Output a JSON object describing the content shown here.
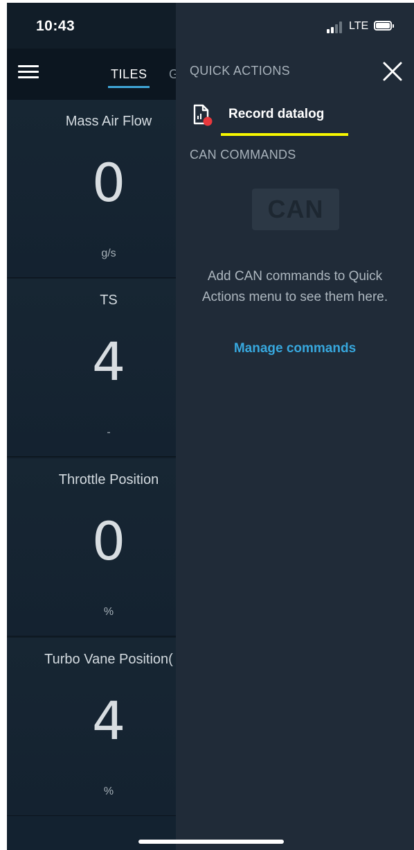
{
  "status_bar": {
    "time": "10:43",
    "network": "LTE"
  },
  "app": {
    "tab_active": "TILES",
    "tab_next_partial": "G"
  },
  "tiles": [
    {
      "title": "Mass Air Flow",
      "value": "0",
      "unit": "g/s"
    },
    {
      "title": "TS",
      "value": "4",
      "unit": "-"
    },
    {
      "title": "Throttle Position",
      "value": "0",
      "unit": "%"
    },
    {
      "title": "Turbo Vane Position(",
      "value": "4",
      "unit": "%"
    }
  ],
  "panel": {
    "quick_actions_label": "QUICK ACTIONS",
    "record_label": "Record datalog",
    "can_commands_label": "CAN COMMANDS",
    "can_badge": "CAN",
    "empty_message": "Add CAN commands to Quick Actions menu to see them here.",
    "manage_link": "Manage commands"
  },
  "colors": {
    "accent": "#37a7dd",
    "highlight": "#f7f700",
    "record_dot": "#e8383d",
    "panel_bg": "#202b38"
  },
  "icons": [
    "hamburger-menu-icon",
    "close-icon",
    "record-datalog-icon",
    "signal-icon",
    "battery-icon"
  ]
}
